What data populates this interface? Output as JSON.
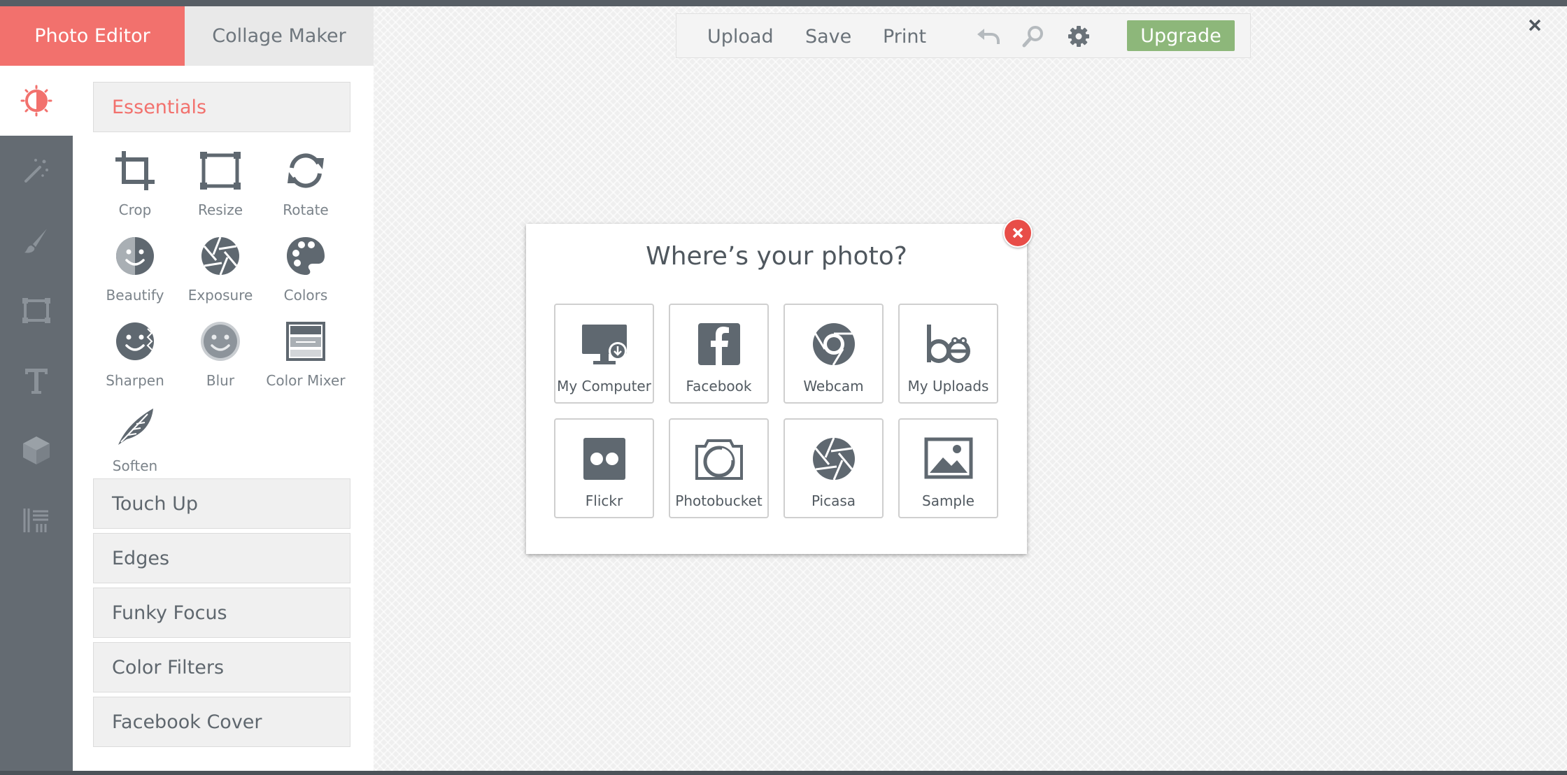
{
  "tabs": {
    "photo_editor": "Photo Editor",
    "collage_maker": "Collage Maker"
  },
  "toolbar": {
    "upload": "Upload",
    "save": "Save",
    "print": "Print",
    "upgrade": "Upgrade",
    "icons": [
      "undo-icon",
      "zoom-icon",
      "gear-icon"
    ]
  },
  "rail": {
    "items": [
      "basic-edits-icon",
      "effects-icon",
      "touch-up-icon",
      "frames-icon",
      "text-icon",
      "overlays-icon",
      "textures-icon"
    ]
  },
  "panel": {
    "essentials": "Essentials",
    "tools": [
      "Crop",
      "Resize",
      "Rotate",
      "Beautify",
      "Exposure",
      "Colors",
      "Sharpen",
      "Blur",
      "Color Mixer",
      "Soften"
    ],
    "sections": [
      "Touch Up",
      "Edges",
      "Funky Focus",
      "Color Filters",
      "Facebook Cover"
    ]
  },
  "dialog": {
    "title": "Where’s your photo?",
    "sources": [
      "My Computer",
      "Facebook",
      "Webcam",
      "My Uploads",
      "Flickr",
      "Photobucket",
      "Picasa",
      "Sample"
    ]
  },
  "colors": {
    "accent": "#f2716d",
    "upgrade": "#8db77a",
    "rail": "#646b72",
    "icon": "#5f6870"
  }
}
